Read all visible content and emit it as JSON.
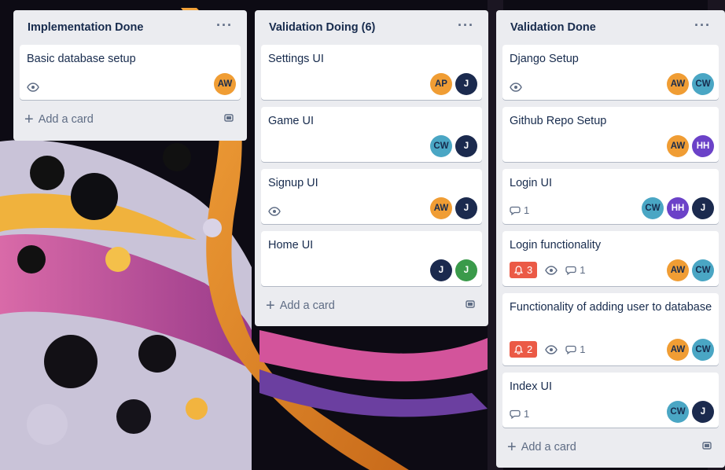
{
  "colors": {
    "list_bg": "#ebecf0",
    "alert": "#eb5a46",
    "text": "#172b4d",
    "muted": "#5e6c84"
  },
  "add_card_label": "Add a card",
  "icons": {
    "menu": "ellipsis-icon",
    "watch": "eye-icon",
    "comment": "comment-icon",
    "alert": "bell-icon",
    "template": "card-template-icon",
    "add": "plus-icon"
  },
  "lists": [
    {
      "title": "Implementation Done",
      "cards": [
        {
          "title": "Basic database setup",
          "watch": true,
          "members": [
            "AW"
          ]
        }
      ]
    },
    {
      "title": "Validation Doing (6)",
      "cards": [
        {
          "title": "Settings UI",
          "members": [
            "AP",
            "J"
          ]
        },
        {
          "title": "Game UI",
          "members": [
            "CW",
            "J"
          ]
        },
        {
          "title": "Signup UI",
          "watch": true,
          "members": [
            "AW",
            "J"
          ]
        },
        {
          "title": "Home UI",
          "members": [
            "J",
            "J"
          ]
        }
      ]
    },
    {
      "title": "Validation Done",
      "cards": [
        {
          "title": "Django Setup",
          "watch": true,
          "members": [
            "AW",
            "CW"
          ]
        },
        {
          "title": "Github Repo Setup",
          "members": [
            "AW",
            "HH"
          ]
        },
        {
          "title": "Login UI",
          "comments": "1",
          "members": [
            "CW",
            "HH",
            "J"
          ]
        },
        {
          "title": "Login functionality",
          "alert": "3",
          "watch": true,
          "comments": "1",
          "members": [
            "AW",
            "CW"
          ]
        },
        {
          "title": "Functionality of adding user to database",
          "alert": "2",
          "watch": true,
          "comments": "1",
          "members": [
            "AW",
            "CW"
          ]
        },
        {
          "title": "Index UI",
          "comments": "1",
          "members": [
            "CW",
            "J"
          ]
        }
      ]
    }
  ]
}
